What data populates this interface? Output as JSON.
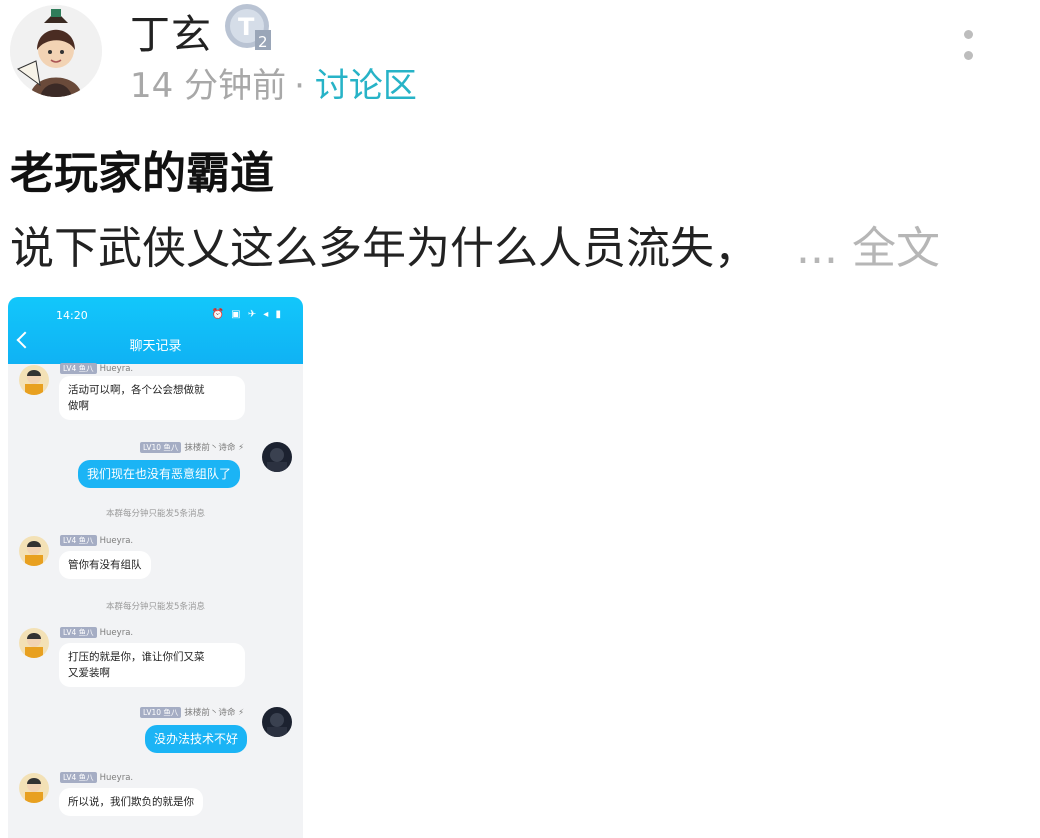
{
  "post": {
    "author": "丁玄",
    "time": "14 分钟前",
    "separator": "·",
    "forum": "讨论区",
    "title": "老玩家的霸道",
    "excerpt": "说下武侠乂这么多年为什么人员流失，",
    "more_label": "... 全文"
  },
  "chat": {
    "status_time": "14:20",
    "status_icons": "⏰ ▣ ✈ ◂ ▮",
    "title": "聊天记录",
    "messages": [
      {
        "level": "LV4 鱼八",
        "nick": "Hueyra.",
        "text_lines": [
          "活动可以啊，各个公会想做就",
          "做啊"
        ]
      },
      {
        "level": "LV10 鱼八",
        "nick": "抹楼前丶诗命",
        "text": "我们现在也没有恶意组队了"
      },
      {
        "system": "本群每分钟只能发5条消息"
      },
      {
        "level": "LV4 鱼八",
        "nick": "Hueyra.",
        "text": "管你有没有组队"
      },
      {
        "system2": "本群每分钟只能发5条消息"
      },
      {
        "level": "LV4 鱼八",
        "nick": "Hueyra.",
        "text_lines": [
          "打压的就是你，谁让你们又菜",
          "又爱装啊"
        ]
      },
      {
        "level": "LV10 鱼八",
        "nick": "抹楼前丶诗命",
        "text": "没办法技术不好"
      },
      {
        "level": "LV4 鱼八",
        "nick": "Hueyra.",
        "text": "所以说，我们欺负的就是你"
      }
    ]
  },
  "colors": {
    "accent": "#27b3c7",
    "header_blue": "#12c7fb",
    "bubble_blue": "#1bb4f5"
  }
}
